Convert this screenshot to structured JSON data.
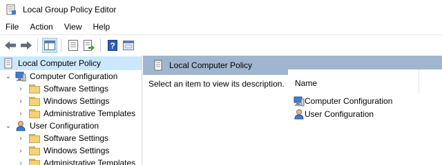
{
  "window": {
    "title": "Local Group Policy Editor"
  },
  "menu": [
    "File",
    "Action",
    "View",
    "Help"
  ],
  "toolbar": {
    "buttons": [
      "back-icon",
      "forward-icon",
      "show-hide-tree-icon",
      "properties-icon",
      "export-list-icon",
      "help-icon",
      "console-view-icon"
    ]
  },
  "tree": {
    "root": "Local Computer Policy",
    "computer": {
      "label": "Computer Configuration",
      "children": [
        "Software Settings",
        "Windows Settings",
        "Administrative Templates"
      ]
    },
    "user": {
      "label": "User Configuration",
      "children": [
        "Software Settings",
        "Windows Settings",
        "Administrative Templates"
      ]
    }
  },
  "right": {
    "header": "Local Computer Policy",
    "description": "Select an item to view its description.",
    "column_name": "Name",
    "items": [
      "Computer Configuration",
      "User Configuration"
    ]
  },
  "colors": {
    "selection": "#cce8ff",
    "header": "#9fb6ce",
    "folder": "#f3d27a"
  }
}
